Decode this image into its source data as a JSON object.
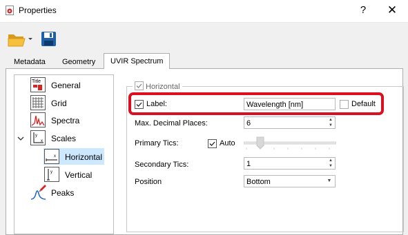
{
  "window": {
    "title": "Properties",
    "help": "?",
    "close": "✕"
  },
  "toolbar": {
    "open_icon": "folder-open-icon",
    "save_icon": "save-disk-icon"
  },
  "tabs": [
    {
      "label": "Metadata",
      "active": false
    },
    {
      "label": "Geometry",
      "active": false
    },
    {
      "label": "UVIR Spectrum",
      "active": true
    }
  ],
  "tree": {
    "items": [
      {
        "label": "General",
        "icon": "title-icon"
      },
      {
        "label": "Grid",
        "icon": "grid-icon"
      },
      {
        "label": "Spectra",
        "icon": "spectra-icon"
      },
      {
        "label": "Scales",
        "icon": "scales-icon",
        "expanded": true
      },
      {
        "label": "Horizontal",
        "icon": "horizontal-scale-icon",
        "selected": true
      },
      {
        "label": "Vertical",
        "icon": "vertical-scale-icon"
      },
      {
        "label": "Peaks",
        "icon": "peaks-icon"
      }
    ]
  },
  "group": {
    "title": "Horizontal",
    "checked": true,
    "label_row": {
      "label": "Label:",
      "checked": true,
      "value": "Wavelength [nm]",
      "default_label": "Default",
      "default_checked": false
    },
    "decimal_places": {
      "label": "Max. Decimal Places:",
      "value": "6"
    },
    "primary_tics": {
      "label": "Primary Tics:",
      "auto_label": "Auto",
      "auto_checked": true
    },
    "secondary_tics": {
      "label": "Secondary Tics:",
      "value": "1"
    },
    "position": {
      "label": "Position",
      "value": "Bottom"
    }
  },
  "colors": {
    "highlight": "#d9101f",
    "selection": "#cce8ff"
  }
}
